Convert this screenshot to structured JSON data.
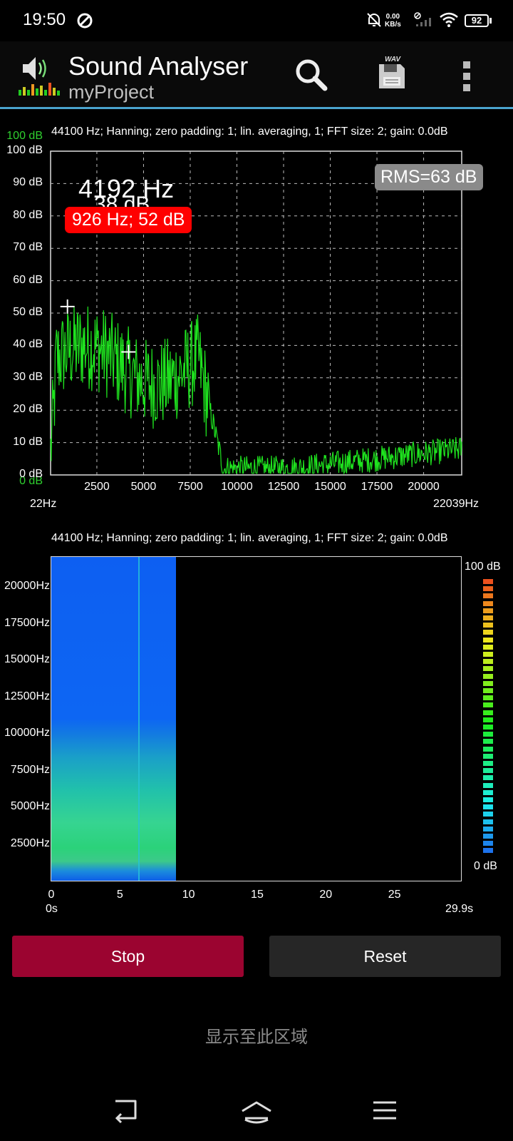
{
  "status_bar": {
    "time": "19:50",
    "net_speed_value": "0.00",
    "net_speed_unit": "KB/s",
    "battery": "92"
  },
  "app_bar": {
    "title": "Sound Analyser",
    "subtitle": "myProject",
    "icons": [
      "speaker-bars-icon",
      "search-icon",
      "save-wav-icon",
      "overflow-menu-icon"
    ],
    "save_icon_label": "WAV",
    "accent_color": "#4aa4cf"
  },
  "spectrum": {
    "info": "44100 Hz; Hanning; zero padding: 1; lin. averaging, 1; FFT size: 2; gain: 0.0dB",
    "max_label": "100 dB",
    "min_label": "0 dB",
    "y_ticks": [
      "100 dB",
      "90 dB",
      "80 dB",
      "70 dB",
      "60 dB",
      "50 dB",
      "40 dB",
      "30 dB",
      "20 dB",
      "10 dB",
      "0 dB"
    ],
    "x_ticks": [
      "2500",
      "5000",
      "7500",
      "10000",
      "12500",
      "15000",
      "17500",
      "20000"
    ],
    "x_min_label": "22Hz",
    "x_max_label": "22039Hz",
    "rms": "RMS=63 dB",
    "cursor_freq": "4192 Hz",
    "cursor_db_partial": "38 dB",
    "peak": "926 Hz; 52 dB",
    "line_color": "#1fe31f"
  },
  "spectrogram": {
    "info": "44100 Hz; Hanning; zero padding: 1; lin. averaging, 1; FFT size: 2; gain: 0.0dB",
    "freq_ticks": [
      "20000Hz",
      "17500Hz",
      "15000Hz",
      "12500Hz",
      "10000Hz",
      "7500Hz",
      "5000Hz",
      "2500Hz"
    ],
    "time_ticks": [
      "0",
      "5",
      "10",
      "15",
      "20",
      "25"
    ],
    "time_start": "0s",
    "time_end": "29.9s",
    "scale_max": "100 dB",
    "scale_min": "0 dB"
  },
  "buttons": {
    "stop": "Stop",
    "reset": "Reset"
  },
  "display_area_text": "显示至此区域",
  "nav_icons": [
    "back-icon",
    "home-icon",
    "menu-icon"
  ]
}
